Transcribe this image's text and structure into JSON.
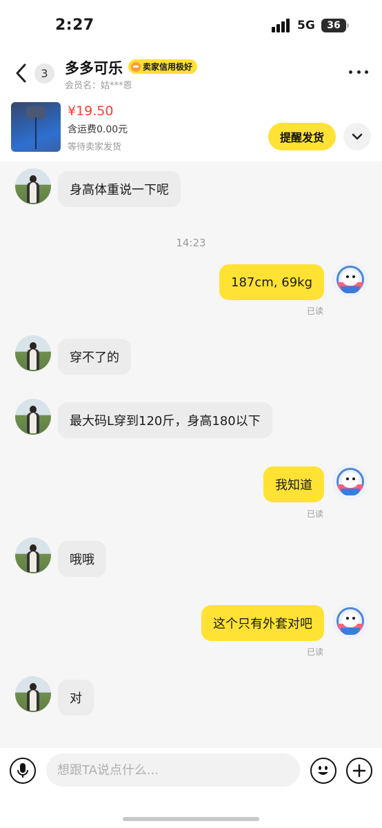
{
  "status_bar": {
    "time": "2:27",
    "network": "5G",
    "battery": "36"
  },
  "header": {
    "back_icon": "chevron-left-icon",
    "unread_count": "3",
    "seller_name": "多多可乐",
    "credit_badge": "卖家信用极好",
    "member_name": "会员名：姑***恩",
    "more_icon": "more-dots-icon"
  },
  "product": {
    "price": "¥19.50",
    "shipping": "含运费0.00元",
    "status": "等待卖家发货",
    "remind_button": "提醒发货",
    "expand_icon": "chevron-down-icon"
  },
  "messages": [
    {
      "side": "left",
      "text": "身高体重说一下呢"
    },
    {
      "type": "time",
      "text": "14:23"
    },
    {
      "side": "right",
      "text": "187cm, 69kg",
      "read": "已读"
    },
    {
      "side": "left",
      "text": "穿不了的"
    },
    {
      "side": "left",
      "text": "最大码L穿到120斤，身高180以下"
    },
    {
      "side": "right",
      "text": "我知道",
      "read": "已读"
    },
    {
      "side": "left",
      "text": "哦哦"
    },
    {
      "side": "right",
      "text": "这个只有外套对吧",
      "read": "已读"
    },
    {
      "side": "left",
      "text": "对"
    }
  ],
  "input_bar": {
    "placeholder": "想跟TA说点什么...",
    "mic_icon": "microphone-icon",
    "emoji_icon": "emoji-smile-icon",
    "plus_icon": "plus-icon"
  },
  "colors": {
    "accent_yellow": "#ffe233",
    "price_red": "#ff3b30",
    "chat_background": "#f6f6f6"
  }
}
